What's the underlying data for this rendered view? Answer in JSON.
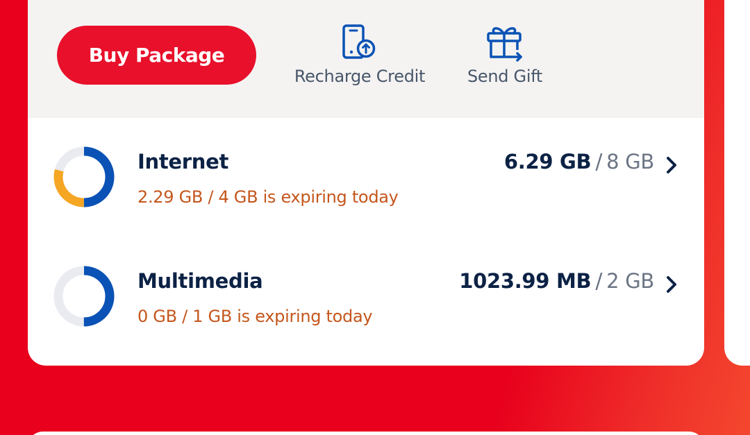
{
  "actions": {
    "buy_label": "Buy Package",
    "recharge": {
      "label": "Recharge Credit",
      "icon": "phone-upload-icon"
    },
    "gift": {
      "label": "Send Gift",
      "icon": "gift-icon"
    }
  },
  "balances": [
    {
      "title": "Internet",
      "used": "6.29 GB",
      "separator": "/",
      "total": "8 GB",
      "expiring": "2.29 GB / 4 GB is expiring today",
      "remaining_fraction": 0.79,
      "expiring_fraction": 0.29
    },
    {
      "title": "Multimedia",
      "used": "1023.99 MB",
      "separator": "/",
      "total": "2 GB",
      "expiring": "0 GB / 1 GB is expiring today",
      "remaining_fraction": 0.5,
      "expiring_fraction": 0
    }
  ],
  "colors": {
    "brand_red": "#e8102b",
    "navy": "#0c2245",
    "donut_remaining": "#0a52b5",
    "donut_expiring": "#f5a623",
    "donut_track": "#e9ebf0",
    "expiring_text": "#c4561c",
    "icon_blue": "#0a52b5"
  }
}
